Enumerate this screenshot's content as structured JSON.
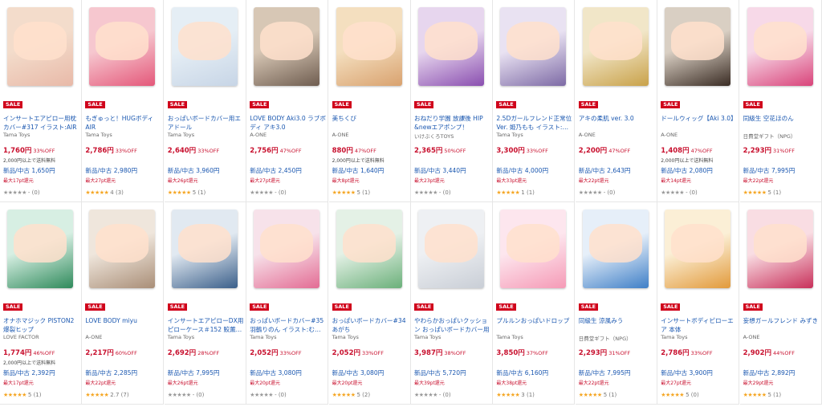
{
  "sale_label": "SALE",
  "used_prefix": "新品/中古",
  "products": [
    {
      "title": "インサートエアピロー用枕カバー#317 イラスト:AIR",
      "seller": "Tama Toys",
      "price": "1,760円",
      "discount": "33%OFF",
      "shipping": "2,000円以上で送料無料",
      "used_price": "1,650円",
      "points": "最大17pt還元",
      "stars": "★★★★★",
      "reviews": "- (0)",
      "stars_rated": false,
      "colors": [
        "#f3dccb",
        "#e8b9a8"
      ]
    },
    {
      "title": "もぎゅっと！HUGボディAIR",
      "seller": "Tama Toys",
      "price": "2,786円",
      "discount": "33%OFF",
      "shipping": "",
      "used_price": "2,980円",
      "points": "最大27pt還元",
      "stars": "★★★★★",
      "reviews": "4 (3)",
      "stars_rated": true,
      "colors": [
        "#f6c7cf",
        "#e4587a"
      ]
    },
    {
      "title": "おっぱいボードカバー用エアドール",
      "seller": "Tama Toys",
      "price": "2,640円",
      "discount": "33%OFF",
      "shipping": "",
      "used_price": "3,960円",
      "points": "最大26pt還元",
      "stars": "★★★★★",
      "reviews": "5 (1)",
      "stars_rated": true,
      "colors": [
        "#e5eef5",
        "#c7d5e6"
      ]
    },
    {
      "title": "LOVE BODY Aki3.0 ラブボディ アキ3.0",
      "seller": "A-ONE",
      "price": "2,756円",
      "discount": "47%OFF",
      "shipping": "",
      "used_price": "2,450円",
      "points": "最大27pt還元",
      "stars": "★★★★★",
      "reviews": "- (0)",
      "stars_rated": false,
      "colors": [
        "#d7c7b5",
        "#6f5d50"
      ]
    },
    {
      "title": "美ちくび",
      "seller": "A-ONE",
      "price": "880円",
      "discount": "47%OFF",
      "shipping": "2,000円以上で送料無料",
      "used_price": "1,640円",
      "points": "最大8pt還元",
      "stars": "★★★★★",
      "reviews": "5 (1)",
      "stars_rated": true,
      "colors": [
        "#f4dfbf",
        "#d9a26f"
      ]
    },
    {
      "title": "おねだり学園 放課後 HIP &newエアポンプ！",
      "seller": "いけぶくろTOYS",
      "price": "2,365円",
      "discount": "50%OFF",
      "shipping": "",
      "used_price": "3,440円",
      "points": "最大23pt還元",
      "stars": "★★★★★",
      "reviews": "- (0)",
      "stars_rated": false,
      "colors": [
        "#e7d6ee",
        "#8a4fb0"
      ]
    },
    {
      "title": "2.5Dガールフレンド正常位 Ver. 姫乃もも イラスト:…",
      "seller": "Tama Toys",
      "price": "3,300円",
      "discount": "33%OFF",
      "shipping": "",
      "used_price": "4,000円",
      "points": "最大33pt還元",
      "stars": "★★★★★",
      "reviews": "1 (1)",
      "stars_rated": true,
      "colors": [
        "#e9e2f2",
        "#7d6aa5"
      ]
    },
    {
      "title": "アキの柔肌 ver. 3.0",
      "seller": "A-ONE",
      "price": "2,200円",
      "discount": "47%OFF",
      "shipping": "",
      "used_price": "2,643円",
      "points": "最大22pt還元",
      "stars": "★★★★★",
      "reviews": "- (0)",
      "stars_rated": false,
      "colors": [
        "#f1e6c8",
        "#c9a24a"
      ]
    },
    {
      "title": "ドールウィッグ【Aki 3.0】",
      "seller": "A-ONE",
      "price": "1,408円",
      "discount": "47%OFF",
      "shipping": "2,000円以上で送料無料",
      "used_price": "2,080円",
      "points": "最大14pt還元",
      "stars": "★★★★★",
      "reviews": "- (0)",
      "stars_rated": false,
      "colors": [
        "#d9cfc3",
        "#3a2c24"
      ]
    },
    {
      "title": "同級生 空花ほのん",
      "seller": "日費堂ギフト（NPG）",
      "price": "2,293円",
      "discount": "31%OFF",
      "shipping": "",
      "used_price": "7,995円",
      "points": "最大22pt還元",
      "stars": "★★★★★",
      "reviews": "5 (1)",
      "stars_rated": true,
      "colors": [
        "#f7d9e8",
        "#d9447a"
      ]
    },
    {
      "title": "オナホマジック PISTON2 爆裂ヒップ",
      "seller": "LOVE FACTOR",
      "price": "1,774円",
      "discount": "46%OFF",
      "shipping": "2,000円以上で送料無料",
      "used_price": "2,392円",
      "points": "最大17pt還元",
      "stars": "★★★★★",
      "reviews": "5 (1)",
      "stars_rated": true,
      "colors": [
        "#d7efe3",
        "#2f8a5b"
      ]
    },
    {
      "title": "LOVE BODY miyu",
      "seller": "A-ONE",
      "price": "2,217円",
      "discount": "60%OFF",
      "shipping": "",
      "used_price": "2,285円",
      "points": "最大22pt還元",
      "stars": "★★★★★",
      "reviews": "2.7 (7)",
      "stars_rated": true,
      "colors": [
        "#efe6dc",
        "#a98e77"
      ]
    },
    {
      "title": "インサートエアピローDX用ピローケース＃152 鮫薫…",
      "seller": "Tama Toys",
      "price": "2,692円",
      "discount": "28%OFF",
      "shipping": "",
      "used_price": "7,995円",
      "points": "最大26pt還元",
      "stars": "★★★★★",
      "reviews": "- (0)",
      "stars_rated": false,
      "colors": [
        "#e1e9f1",
        "#3b5f8a"
      ]
    },
    {
      "title": "おっぱいボードカバー#35 羽鶴りのん イラスト:む…",
      "seller": "Tama Toys",
      "price": "2,052円",
      "discount": "33%OFF",
      "shipping": "",
      "used_price": "3,080円",
      "points": "最大20pt還元",
      "stars": "★★★★★",
      "reviews": "- (0)",
      "stars_rated": false,
      "colors": [
        "#f7e2ea",
        "#e36c94"
      ]
    },
    {
      "title": "おっぱいボードカバー#34 あがち",
      "seller": "Tama Toys",
      "price": "2,052円",
      "discount": "33%OFF",
      "shipping": "",
      "used_price": "3,080円",
      "points": "最大20pt還元",
      "stars": "★★★★★",
      "reviews": "5 (2)",
      "stars_rated": true,
      "colors": [
        "#e4f1e6",
        "#6bb07a"
      ]
    },
    {
      "title": "やわらかおっぱいクッション おっぱいボードカバー用",
      "seller": "Tama Toys",
      "price": "3,987円",
      "discount": "38%OFF",
      "shipping": "",
      "used_price": "5,720円",
      "points": "最大39pt還元",
      "stars": "★★★★★",
      "reviews": "- (0)",
      "stars_rated": false,
      "colors": [
        "#eef0f3",
        "#c9ced6"
      ]
    },
    {
      "title": "プルルンおっぱいドロップ",
      "seller": "Tama Toys",
      "price": "3,850円",
      "discount": "37%OFF",
      "shipping": "",
      "used_price": "6,160円",
      "points": "最大38pt還元",
      "stars": "★★★★★",
      "reviews": "3 (1)",
      "stars_rated": true,
      "colors": [
        "#fde6ee",
        "#f59ab6"
      ]
    },
    {
      "title": "同級生 涼風みう",
      "seller": "日費堂ギフト（NPG）",
      "price": "2,293円",
      "discount": "31%OFF",
      "shipping": "",
      "used_price": "7,995円",
      "points": "最大22pt還元",
      "stars": "★★★★★",
      "reviews": "5 (1)",
      "stars_rated": true,
      "colors": [
        "#e6eff9",
        "#3f7fc7"
      ]
    },
    {
      "title": "インサートボディピローエア 本体",
      "seller": "Tama Toys",
      "price": "2,786円",
      "discount": "33%OFF",
      "shipping": "",
      "used_price": "3,900円",
      "points": "最大27pt還元",
      "stars": "★★★★★",
      "reviews": "5 (0)",
      "stars_rated": true,
      "colors": [
        "#fbefd6",
        "#e29a3b"
      ]
    },
    {
      "title": "妄想ガールフレンド みずき",
      "seller": "A-ONE",
      "price": "2,902円",
      "discount": "44%OFF",
      "shipping": "",
      "used_price": "2,892円",
      "points": "最大29pt還元",
      "stars": "★★★★★",
      "reviews": "5 (1)",
      "stars_rated": true,
      "colors": [
        "#f9dde3",
        "#c8305a"
      ]
    }
  ]
}
